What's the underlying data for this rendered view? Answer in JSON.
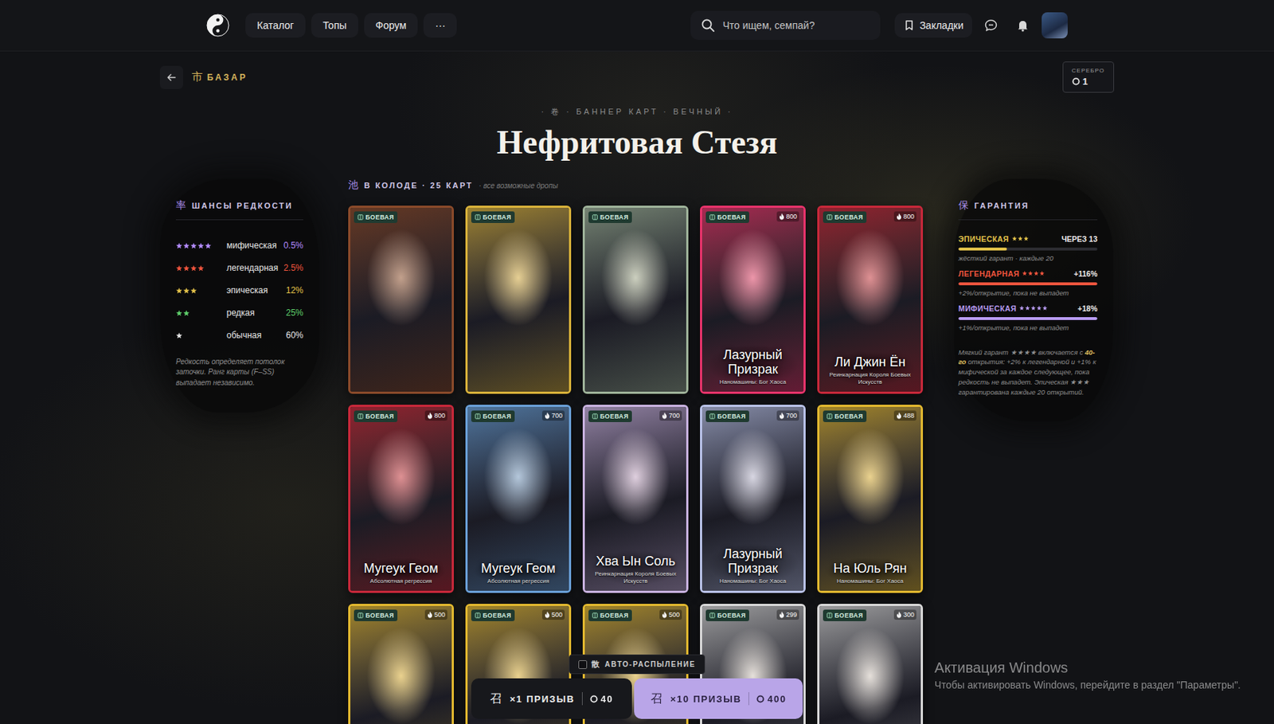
{
  "nav": {
    "items": [
      {
        "label": "Каталог"
      },
      {
        "label": "Топы"
      },
      {
        "label": "Форум"
      },
      {
        "label": "···"
      }
    ],
    "search_placeholder": "Что ищем, семпай?",
    "bookmarks": "Закладки"
  },
  "breadcrumb": {
    "icon": "市",
    "label": "БАЗАР"
  },
  "currency": {
    "label": "СЕРЕБРО",
    "value": "1"
  },
  "banner": {
    "kicker": "· 卷 · БАННЕР КАРТ · ВЕЧНЫЙ ·",
    "title": "Нефритовая Стезя"
  },
  "odds": {
    "icon": "率",
    "title": "ШАНСЫ РЕДКОСТИ",
    "rows": [
      {
        "stars": 5,
        "name": "мифическая",
        "chance": "0.5%",
        "color": "#b48cff"
      },
      {
        "stars": 4,
        "name": "легендарная",
        "chance": "2.5%",
        "color": "#f0553e"
      },
      {
        "stars": 3,
        "name": "эпическая",
        "chance": "12%",
        "color": "#e3c24a"
      },
      {
        "stars": 2,
        "name": "редкая",
        "chance": "25%",
        "color": "#5fcf6b"
      },
      {
        "stars": 1,
        "name": "обычная",
        "chance": "60%",
        "color": "#e6e6e6"
      }
    ],
    "note": "Редкость определяет потолок заточки. Ранг карты (F–SS) выпадает независимо."
  },
  "deck": {
    "icon": "池",
    "title": "В КОЛОДЕ · 25 КАРТ",
    "hint": "· все возможные дропы",
    "cards": [
      {
        "type": "БОЕВАЯ",
        "color": "#8a4a2a"
      },
      {
        "type": "БОЕВАЯ",
        "color": "#d9b23a"
      },
      {
        "type": "БОЕВАЯ",
        "color": "#9fb39a"
      },
      {
        "type": "БОЕВАЯ",
        "power": "800",
        "name": "Лазурный Призрак",
        "series": "Наномашины: Бог Хаоса",
        "color": "#e8336b"
      },
      {
        "type": "БОЕВАЯ",
        "power": "800",
        "name": "Ли Джин Ён",
        "series": "Реинкарнация Короля Боевых Искусств",
        "color": "#c8283a"
      },
      {
        "type": "БОЕВАЯ",
        "power": "800",
        "name": "Мугеук Геом",
        "series": "Абсолютная регрессия",
        "color": "#c8283a"
      },
      {
        "type": "БОЕВАЯ",
        "power": "700",
        "name": "Мугеук Геом",
        "series": "Абсолютная регрессия",
        "color": "#6aa0d8"
      },
      {
        "type": "БОЕВАЯ",
        "power": "700",
        "name": "Хва Ын Соль",
        "series": "Реинкарнация Короля Боевых Искусств",
        "color": "#c9b2e0"
      },
      {
        "type": "БОЕВАЯ",
        "power": "700",
        "name": "Лазурный Призрак",
        "series": "Наномашины: Бог Хаоса",
        "color": "#b9c2e8"
      },
      {
        "type": "БОЕВАЯ",
        "power": "488",
        "name": "На Юль Рян",
        "series": "Наномашины: Бог Хаоса",
        "color": "#e2b82f"
      },
      {
        "type": "БОЕВАЯ",
        "power": "500",
        "color": "#e2b82f"
      },
      {
        "type": "БОЕВАЯ",
        "power": "500",
        "color": "#e2b82f"
      },
      {
        "type": "БОЕВАЯ",
        "power": "500",
        "color": "#e2b82f"
      },
      {
        "type": "БОЕВАЯ",
        "power": "299",
        "color": "#d8d8d8"
      },
      {
        "type": "БОЕВАЯ",
        "power": "300",
        "color": "#d8d8d8"
      }
    ]
  },
  "guarantee": {
    "icon": "保",
    "title": "ГАРАНТИЯ",
    "items": [
      {
        "label": "ЭПИЧЕСКАЯ",
        "stars": 3,
        "value": "ЧЕРЕЗ 13",
        "level": 0.35,
        "sub": "жёсткий гарант · каждые 20",
        "color": "#e3c24a"
      },
      {
        "label": "ЛЕГЕНДАРНАЯ",
        "stars": 4,
        "value": "+116%",
        "level": 1,
        "sub": "+2%/открытие, пока не выпадет",
        "color": "#f0553e"
      },
      {
        "label": "МИФИЧЕСКАЯ",
        "stars": 5,
        "value": "+18%",
        "level": 1,
        "sub": "+1%/открытие, пока не выпадет",
        "color": "#b79bf0"
      }
    ],
    "note": [
      {
        "text": "Мягкий гарант ★★★★ включается с ",
        "bold": false
      },
      {
        "text": "40-го",
        "bold": true
      },
      {
        "text": " открытия: +2% к легендарной и +1% к мифической за каждое следующее, пока редкость не выпадет. Эпическая ★★★ гарантирована каждые 20 открытий.",
        "bold": false
      }
    ]
  },
  "summon": {
    "auto": {
      "icon": "散",
      "label": "АВТО-РАСПЫЛЕНИЕ",
      "checked": false
    },
    "buttons": [
      {
        "icon": "召",
        "label": "×1 ПРИЗЫВ",
        "cost": "40",
        "kind": "single"
      },
      {
        "icon": "召",
        "label": "×10 ПРИЗЫВ",
        "cost": "400",
        "kind": "multi"
      }
    ]
  },
  "watermark": {
    "title": "Активация Windows",
    "text": "Чтобы активировать Windows, перейдите в раздел \"Параметры\"."
  }
}
